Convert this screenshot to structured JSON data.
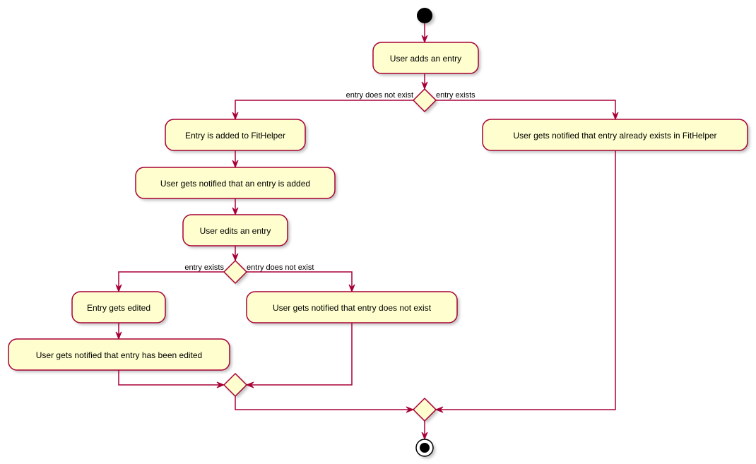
{
  "diagram": {
    "type": "uml-activity",
    "colors": {
      "activity_fill": "#FEFECE",
      "border": "#A80036",
      "start_node": "#000000",
      "text": "#000000"
    },
    "activities": {
      "add_entry": "User adds an entry",
      "entry_added": "Entry is added to FitHelper",
      "notify_added": "User gets notified that an entry is added",
      "edit_entry": "User edits an entry",
      "entry_edited": "Entry gets edited",
      "notify_edited": "User gets notified that entry has been edited",
      "notify_not_exist": "User gets notified that entry does not exist",
      "notify_already_exists": "User gets notified that entry already exists in FitHelper"
    },
    "guards": {
      "d1_left": "entry does not exist",
      "d1_right": "entry exists",
      "d2_left": "entry exists",
      "d2_right": "entry does not exist"
    }
  }
}
